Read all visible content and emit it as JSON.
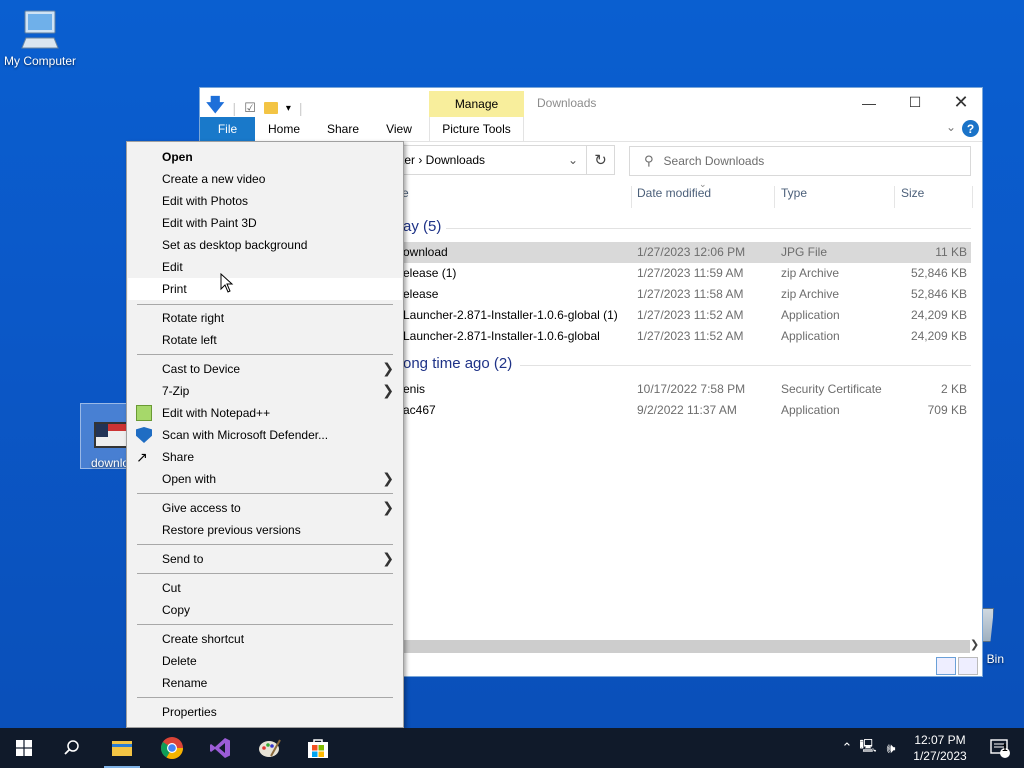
{
  "desktop": {
    "my_computer_label": "My Computer",
    "download_label": "downlo",
    "recycle_label": "e Bin"
  },
  "explorer": {
    "title": "Downloads",
    "manage_tab": "Manage",
    "ribbon_tabs": [
      "File",
      "Home",
      "Share",
      "View",
      "Picture Tools"
    ],
    "address_path": "ter  ›  Downloads",
    "search_placeholder": "Search Downloads",
    "columns": {
      "name": "e",
      "date": "Date modified",
      "type": "Type",
      "size": "Size"
    },
    "groups": [
      {
        "label": "ay (5)",
        "rows": [
          {
            "name": "ownload",
            "date": "1/27/2023 12:06 PM",
            "type": "JPG File",
            "size": "11 KB",
            "selected": true
          },
          {
            "name": "elease (1)",
            "date": "1/27/2023 11:59 AM",
            "type": "zip Archive",
            "size": "52,846 KB"
          },
          {
            "name": "elease",
            "date": "1/27/2023 11:58 AM",
            "type": "zip Archive",
            "size": "52,846 KB"
          },
          {
            "name": "Launcher-2.871-Installer-1.0.6-global (1)",
            "date": "1/27/2023 11:52 AM",
            "type": "Application",
            "size": "24,209 KB"
          },
          {
            "name": "Launcher-2.871-Installer-1.0.6-global",
            "date": "1/27/2023 11:52 AM",
            "type": "Application",
            "size": "24,209 KB"
          }
        ]
      },
      {
        "label": "ong time ago (2)",
        "rows": [
          {
            "name": "enis",
            "date": "10/17/2022 7:58 PM",
            "type": "Security Certificate",
            "size": "2 KB"
          },
          {
            "name": "ac467",
            "date": "9/2/2022 11:37 AM",
            "type": "Application",
            "size": "709 KB"
          }
        ]
      }
    ]
  },
  "context_menu": {
    "items": [
      "Open",
      "Create a new video",
      "Edit with Photos",
      "Edit with Paint 3D",
      "Set as desktop background",
      "Edit",
      "Print",
      "Rotate right",
      "Rotate left",
      "Cast to Device",
      "7-Zip",
      "Edit with Notepad++",
      "Scan with Microsoft Defender...",
      "Share",
      "Open with",
      "Give access to",
      "Restore previous versions",
      "Send to",
      "Cut",
      "Copy",
      "Create shortcut",
      "Delete",
      "Rename",
      "Properties"
    ]
  },
  "taskbar": {
    "time": "12:07 PM",
    "date": "1/27/2023",
    "notification_count": "1"
  }
}
